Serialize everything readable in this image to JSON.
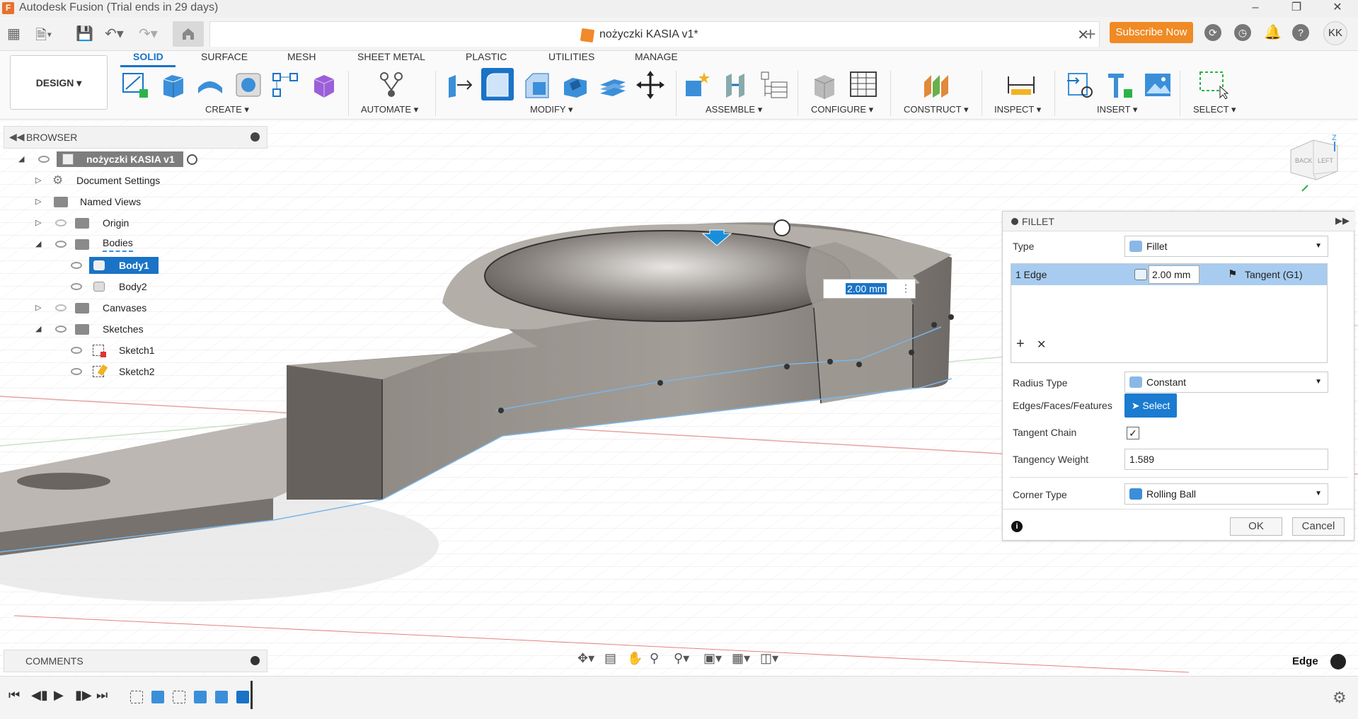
{
  "app": {
    "title": "Autodesk Fusion (Trial ends in 29 days)",
    "document_tab": "nożyczki KASIA v1*",
    "subscribe_label": "Subscribe Now",
    "user_initials": "KK",
    "brand_color": "#f08a24",
    "accent_color": "#1a73c6"
  },
  "workspace": {
    "label": "DESIGN"
  },
  "ribbon": {
    "tabs": [
      "SOLID",
      "SURFACE",
      "MESH",
      "SHEET METAL",
      "PLASTIC",
      "UTILITIES",
      "MANAGE"
    ],
    "active_tab": "SOLID",
    "groups": [
      "CREATE",
      "AUTOMATE",
      "MODIFY",
      "ASSEMBLE",
      "CONFIGURE",
      "CONSTRUCT",
      "INSPECT",
      "INSERT",
      "SELECT"
    ]
  },
  "browser": {
    "title": "BROWSER",
    "root": "nożyczki KASIA v1",
    "items": [
      {
        "label": "Document Settings",
        "icon": "gear-icon"
      },
      {
        "label": "Named Views",
        "icon": "folder-icon"
      },
      {
        "label": "Origin",
        "icon": "folder-icon"
      },
      {
        "label": "Bodies",
        "icon": "folder-icon"
      },
      {
        "label": "Body1",
        "icon": "body-icon",
        "selected": true
      },
      {
        "label": "Body2",
        "icon": "body-icon"
      },
      {
        "label": "Canvases",
        "icon": "folder-icon"
      },
      {
        "label": "Sketches",
        "icon": "folder-icon"
      },
      {
        "label": "Sketch1",
        "icon": "sketch-icon"
      },
      {
        "label": "Sketch2",
        "icon": "sketch-icon"
      }
    ]
  },
  "fillet": {
    "title": "FILLET",
    "type_label": "Type",
    "type_value": "Fillet",
    "edge_label": "1 Edge",
    "edge_radius": "2.00 mm",
    "edge_continuity": "Tangent (G1)",
    "radius_type_label": "Radius Type",
    "radius_type_value": "Constant",
    "edges_label": "Edges/Faces/Features",
    "select_label": "Select",
    "tangent_chain_label": "Tangent Chain",
    "tangent_chain_checked": true,
    "tangency_weight_label": "Tangency Weight",
    "tangency_weight_value": "1.589",
    "corner_type_label": "Corner Type",
    "corner_type_value": "Rolling Ball",
    "ok_label": "OK",
    "cancel_label": "Cancel"
  },
  "viewport": {
    "dimension_input": "2.00 mm",
    "selection_filter": "Edge",
    "viewcube_faces": [
      "BACK",
      "LEFT"
    ],
    "viewcube_axis": "Z"
  },
  "comments": {
    "title": "COMMENTS"
  }
}
